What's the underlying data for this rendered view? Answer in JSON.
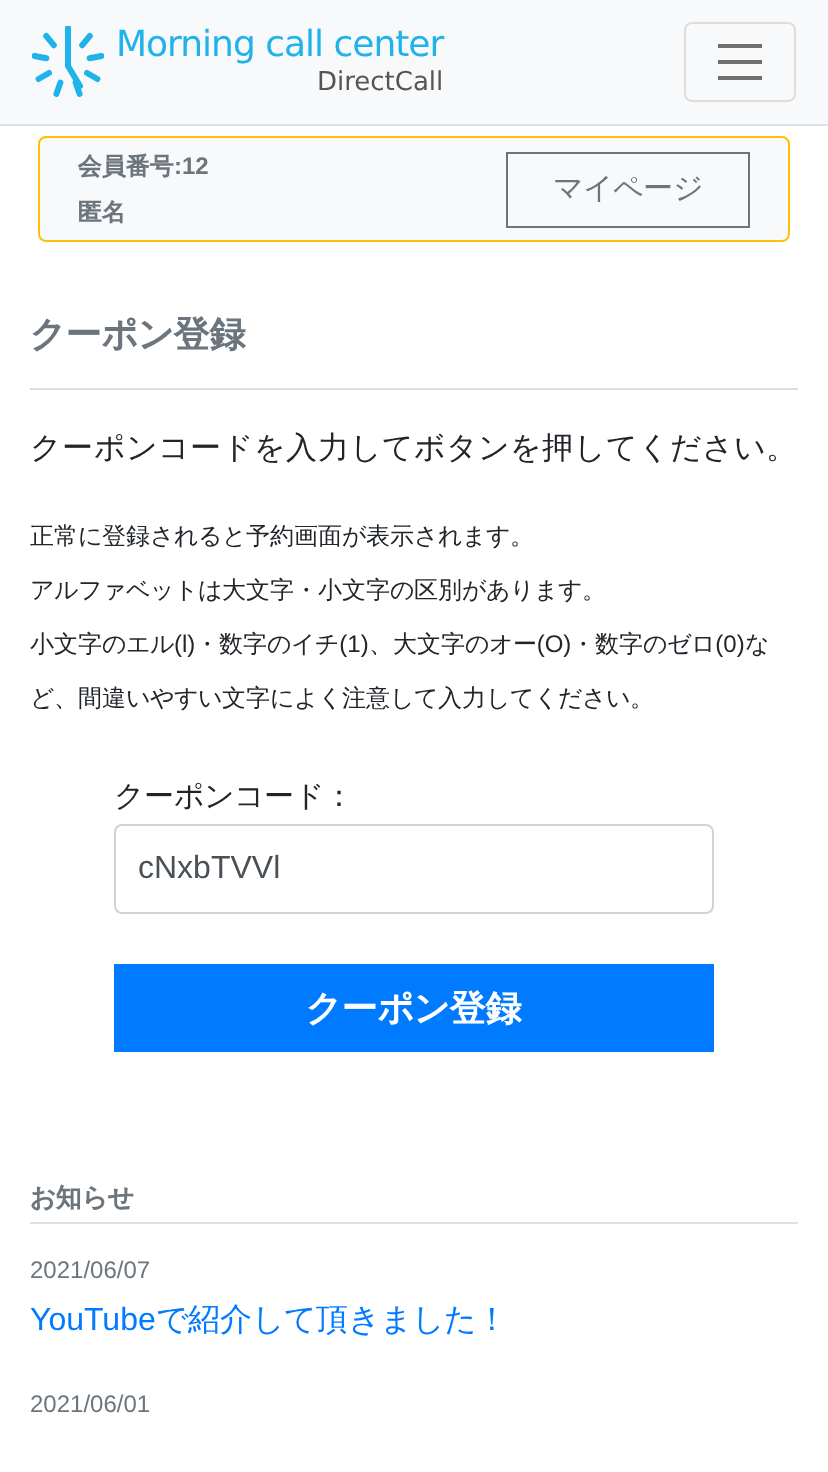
{
  "header": {
    "brand": "Morning call center",
    "sub_brand": "DirectCall"
  },
  "member": {
    "number": "会員番号:12",
    "name": "匿名",
    "button": "マイページ"
  },
  "page_title": "クーポン登録",
  "lead": "クーポンコードを入力してボタンを押してください。",
  "notes": [
    "正常に登録されると予約画面が表示されます。",
    "アルファベットは大文字・小文字の区別があります。",
    "小文字のエル(l)・数字のイチ(1)、大文字のオー(O)・数字のゼロ(0)など、間違いやすい文字によく注意して入力してください。"
  ],
  "form": {
    "label": "クーポンコード：",
    "value": "cNxbTVVl",
    "submit": "クーポン登録"
  },
  "news": {
    "title": "お知らせ",
    "items": [
      {
        "date": "2021/06/07",
        "title": "YouTubeで紹介して頂きました！"
      },
      {
        "date": "2021/06/01"
      }
    ]
  }
}
